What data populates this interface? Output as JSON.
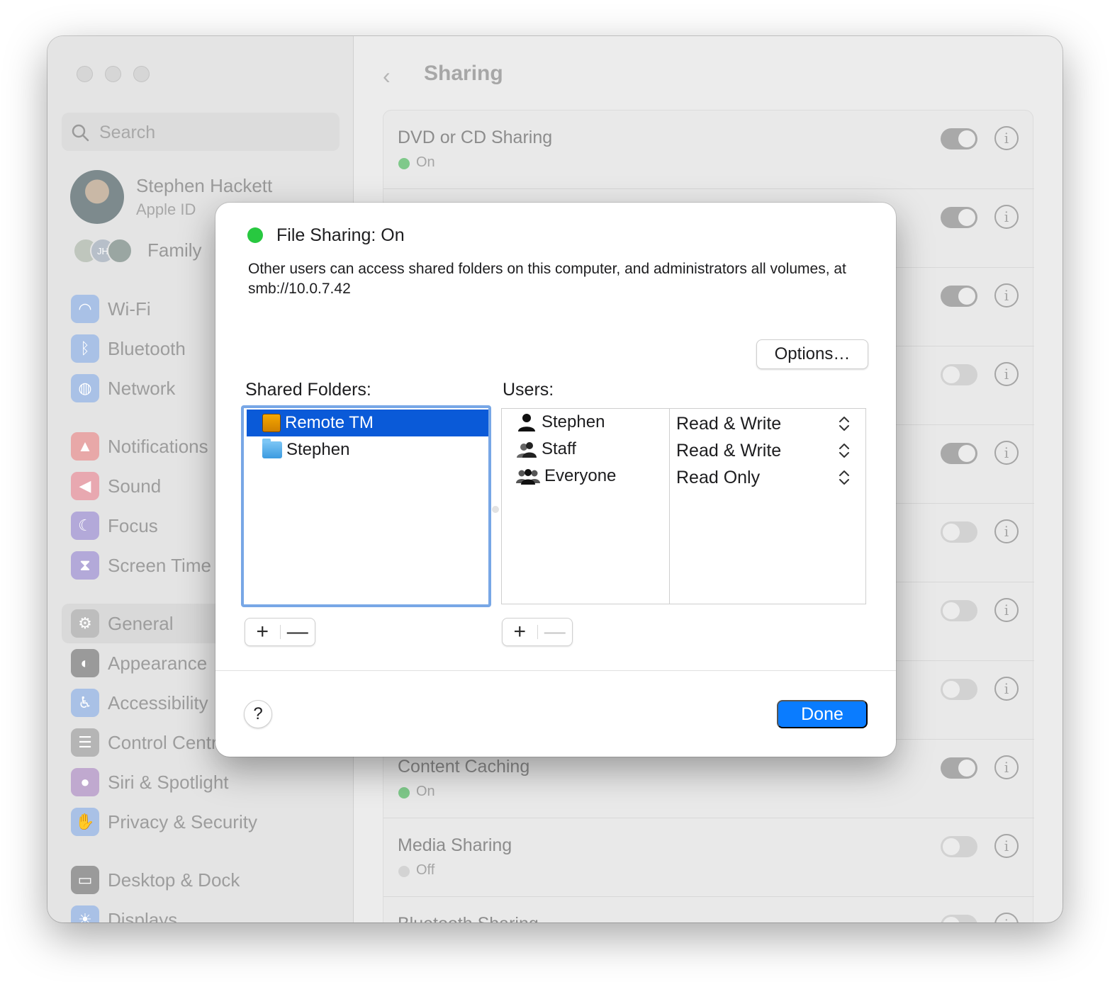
{
  "sidebar": {
    "search_placeholder": "Search",
    "user_name": "Stephen Hackett",
    "user_sub": "Apple ID",
    "family_label": "Family",
    "family_initials": "JH",
    "items": [
      {
        "label": "Wi-Fi",
        "icon": "wifi-icon",
        "color": "#a9c1e6"
      },
      {
        "label": "Bluetooth",
        "icon": "bluetooth-icon",
        "color": "#a9c1e6"
      },
      {
        "label": "Network",
        "icon": "globe-icon",
        "color": "#a9c1e6"
      },
      {
        "label": "Notifications",
        "icon": "bell-icon",
        "color": "#e8a8a8"
      },
      {
        "label": "Sound",
        "icon": "speaker-icon",
        "color": "#e8a8b0"
      },
      {
        "label": "Focus",
        "icon": "moon-icon",
        "color": "#b3a9d9"
      },
      {
        "label": "Screen Time",
        "icon": "hourglass-icon",
        "color": "#b3a9d9"
      },
      {
        "label": "General",
        "icon": "gear-icon",
        "color": "#bdbdbd"
      },
      {
        "label": "Appearance",
        "icon": "appearance-icon",
        "color": "#9a9a9a"
      },
      {
        "label": "Accessibility",
        "icon": "accessibility-icon",
        "color": "#a9c1e6"
      },
      {
        "label": "Control Centre",
        "icon": "toggles-icon",
        "color": "#b5b5b5"
      },
      {
        "label": "Siri & Spotlight",
        "icon": "siri-icon",
        "color": "#c0a9cf"
      },
      {
        "label": "Privacy & Security",
        "icon": "hand-icon",
        "color": "#a9c1e6"
      },
      {
        "label": "Desktop & Dock",
        "icon": "dock-icon",
        "color": "#9a9a9a"
      },
      {
        "label": "Displays",
        "icon": "sun-icon",
        "color": "#a9c1e6"
      }
    ]
  },
  "content": {
    "back_icon": "chevron-left-icon",
    "title": "Sharing",
    "rows": [
      {
        "title": "DVD or CD Sharing",
        "status": "On",
        "on": true
      },
      {
        "title": "",
        "status": "",
        "on": true
      },
      {
        "title": "",
        "status": "",
        "on": true
      },
      {
        "title": "",
        "status": "",
        "on": false
      },
      {
        "title": "",
        "status": "",
        "on": true
      },
      {
        "title": "",
        "status": "",
        "on": false
      },
      {
        "title": "",
        "status": "",
        "on": false
      },
      {
        "title": "",
        "status": "",
        "on": false
      },
      {
        "title": "Content Caching",
        "status": "On",
        "on": true
      },
      {
        "title": "Media Sharing",
        "status": "Off",
        "on": false
      },
      {
        "title": "Bluetooth Sharing",
        "status": "",
        "on": false
      }
    ],
    "info_glyph": "i"
  },
  "dialog": {
    "title": "File Sharing: On",
    "status_color": "#28c840",
    "description": "Other users can access shared folders on this computer, and administrators all volumes, at smb://10.0.7.42",
    "options_label": "Options…",
    "shared_folders_label": "Shared Folders:",
    "users_label": "Users:",
    "folders": [
      {
        "name": "Remote TM",
        "icon": "drive-icon",
        "selected": true
      },
      {
        "name": "Stephen",
        "icon": "home-folder-icon",
        "selected": false
      }
    ],
    "users": [
      {
        "name": "Stephen",
        "icon": "person-icon",
        "permission": "Read & Write"
      },
      {
        "name": "Staff",
        "icon": "group-icon",
        "permission": "Read & Write"
      },
      {
        "name": "Everyone",
        "icon": "everyone-icon",
        "permission": "Read Only"
      }
    ],
    "add_glyph": "+",
    "remove_glyph": "—",
    "help_label": "?",
    "done_label": "Done",
    "accent": "#0a7cff"
  }
}
